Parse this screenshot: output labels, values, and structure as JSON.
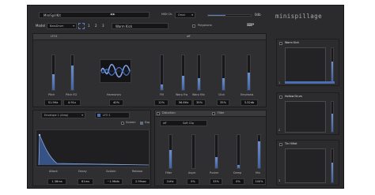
{
  "header": {
    "kit_name": "MiniSpillKit",
    "midi_label": "MIDI Ch.",
    "midi_value": "Omni",
    "volume_readout": "0db",
    "brand": "minispillage"
  },
  "model_bar": {
    "model_label": "Model",
    "model_value": "BassDrum",
    "voice_numbers": [
      "1",
      "2",
      "3"
    ],
    "preset_name": "Warm Kick",
    "polyphonic_label": "Polyphonic"
  },
  "lfo": {
    "label": "LFO1",
    "state": "off"
  },
  "voice_params": [
    {
      "label": "Pitch",
      "value": "51.9Hz",
      "level": 0.45
    },
    {
      "label": "Pitch EG",
      "value": "4.91x",
      "level": 0.7
    },
    {
      "label": "Harmonics",
      "value": "40%"
    },
    {
      "label": "FM",
      "value": "12%",
      "level": 0.15
    },
    {
      "label": "Warp Frq",
      "value": "56.6Hz",
      "level": 0.4
    },
    {
      "label": "Warp Mix",
      "value": "35%",
      "level": 0.35
    },
    {
      "label": "Click",
      "value": "35%",
      "level": 0.35
    },
    {
      "label": "Emphasis",
      "value": "3.32db",
      "level": 0.5
    }
  ],
  "envelope": {
    "selector": "Envelope 1 (Amp)",
    "lfo_target": "LFO 1",
    "sustain_label": "Sustain",
    "exp_label": "Exp",
    "params": [
      {
        "label": "Attack",
        "value": "1.38ms"
      },
      {
        "label": "Decay",
        "value": "61ms"
      },
      {
        "label": "Sustain",
        "value": "~1.96db"
      },
      {
        "label": "Release",
        "value": "2.99sec"
      }
    ]
  },
  "distortion": {
    "tab_distortion": "Distortion",
    "tab_filter": "Filter",
    "mode": "off",
    "type": "Soft Clip",
    "params": [
      {
        "label": "Filter",
        "value": "1kHz",
        "level": 0.55
      },
      {
        "label": "Asym",
        "value": "0%",
        "level": 0.0
      },
      {
        "label": "Pusher",
        "value": "33%",
        "level": 0.33
      },
      {
        "label": "Damp",
        "value": "0%",
        "level": 0.1
      },
      {
        "label": "Mix",
        "value": "100%",
        "level": 0.8
      }
    ]
  },
  "slots": [
    {
      "name": "Warm Kick",
      "value": "1"
    },
    {
      "name": "Hollow Drum",
      "value": "2"
    },
    {
      "name": "Tin HiHat",
      "value": "3"
    }
  ],
  "colors": {
    "accent": "#4a6fb5",
    "panel": "#2b2b2d",
    "text": "#c8c8cc"
  }
}
